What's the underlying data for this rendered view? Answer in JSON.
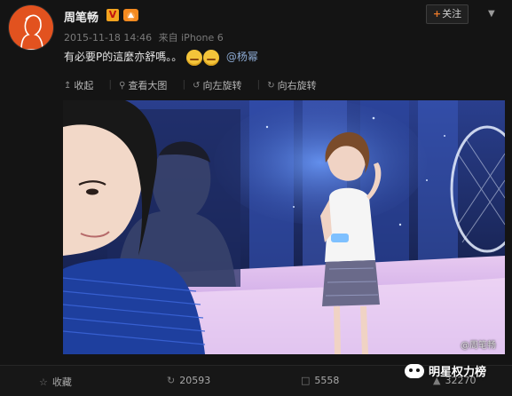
{
  "post": {
    "username": "周笔畅",
    "verified_badge": "V",
    "follow_label": "关注",
    "follow_icon": "plus-icon",
    "timestamp": "2015-11-18 14:46",
    "source_prefix": "来自",
    "source": "iPhone 6",
    "text": "有必要P的這麼亦舒嗎。。",
    "mention": "@杨幂"
  },
  "toolbar": {
    "collapse": "收起",
    "view_large": "查看大图",
    "rotate_left": "向左旋转",
    "rotate_right": "向右旋转"
  },
  "photo": {
    "watermark": "@周笔畅"
  },
  "stats": {
    "favorite": "收藏",
    "repost_count": "20593",
    "comment_count": "5558",
    "like_count": "32270"
  },
  "brand": {
    "name": "明星权力榜"
  },
  "colors": {
    "accent": "#e8792a",
    "avatar_bg": "#e2521f",
    "link": "#8aa7cf"
  }
}
